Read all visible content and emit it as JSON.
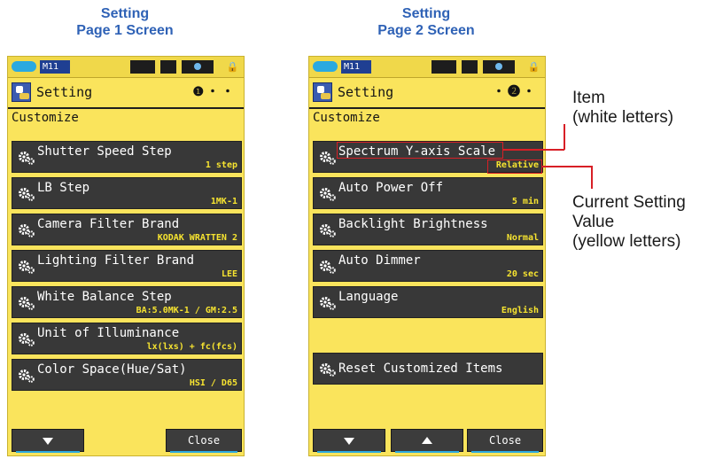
{
  "captions": {
    "page1": {
      "line1": "Setting",
      "line2": "Page 1 Screen"
    },
    "page2": {
      "line1": "Setting",
      "line2": "Page 2 Screen"
    }
  },
  "screens": {
    "page1": {
      "status": {
        "memory": "M11"
      },
      "title": "Setting",
      "pager": "❶・・",
      "section": "Customize",
      "items": [
        {
          "label": "Shutter Speed Step",
          "value": "1 step"
        },
        {
          "label": "LB Step",
          "value": "1MK-1"
        },
        {
          "label": "Camera Filter Brand",
          "value": "KODAK WRATTEN 2"
        },
        {
          "label": "Lighting Filter Brand",
          "value": "LEE"
        },
        {
          "label": "White Balance Step",
          "value": "BA:5.0MK-1 / GM:2.5"
        },
        {
          "label": "Unit of Illuminance",
          "value": "lx(lxs) + fc(fcs)"
        },
        {
          "label": "Color Space(Hue/Sat)",
          "value": "HSI / D65"
        }
      ],
      "buttons": {
        "down": "down-arrow-icon",
        "close": "Close"
      }
    },
    "page2": {
      "status": {
        "memory": "M11"
      },
      "title": "Setting",
      "pager": "・❷・",
      "section": "Customize",
      "items": [
        {
          "label": "Spectrum Y-axis Scale",
          "value": "Relative"
        },
        {
          "label": "Auto Power Off",
          "value": "5 min"
        },
        {
          "label": "Backlight Brightness",
          "value": "Normal"
        },
        {
          "label": "Auto Dimmer",
          "value": "20 sec"
        },
        {
          "label": "Language",
          "value": "English"
        }
      ],
      "reset": "Reset Customized Items",
      "buttons": {
        "down": "down-arrow-icon",
        "up": "up-arrow-icon",
        "close": "Close"
      }
    }
  },
  "annotations": {
    "item": {
      "line1": "Item",
      "line2": "(white letters)"
    },
    "current": {
      "line1": "Current Setting",
      "line2": "Value",
      "line3": "(yellow letters)"
    }
  },
  "colors": {
    "caption": "#2f62b6",
    "screen_bg": "#fae45c",
    "item_bg": "#383838",
    "item_text": "#ffffff",
    "value_text": "#f7e430",
    "callout": "#d81f26"
  }
}
